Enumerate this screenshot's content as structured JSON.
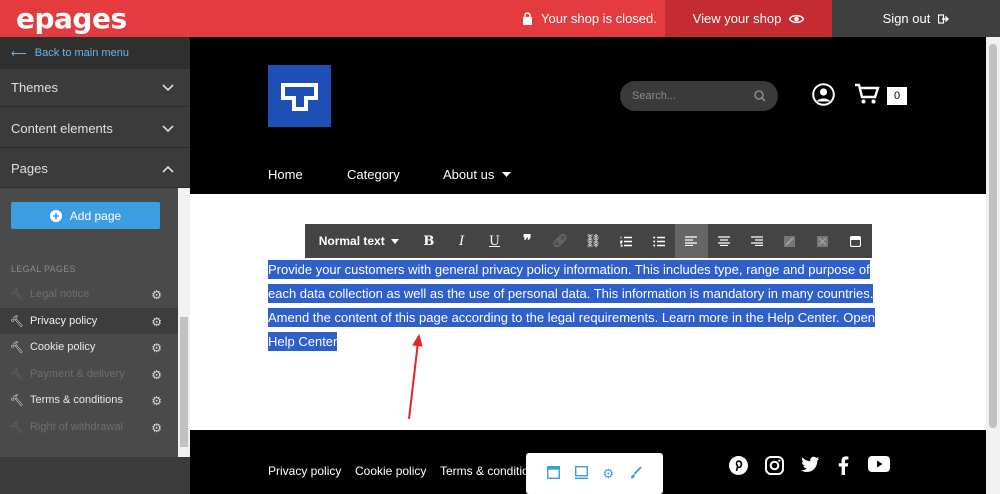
{
  "topbar": {
    "logo": "epages",
    "closed_text": "Your shop is closed.",
    "view_shop": "View your shop",
    "sign_out": "Sign out"
  },
  "sidebar": {
    "back": "Back to main menu",
    "sections": [
      "Themes",
      "Content elements",
      "Pages"
    ],
    "add_page": "Add page",
    "legal_heading": "LEGAL PAGES",
    "pages": [
      {
        "label": "Legal notice",
        "state": "dim"
      },
      {
        "label": "Privacy policy",
        "state": "active"
      },
      {
        "label": "Cookie policy",
        "state": "normal"
      },
      {
        "label": "Payment & delivery",
        "state": "dim"
      },
      {
        "label": "Terms & conditions",
        "state": "normal"
      },
      {
        "label": "Right of withdrawal",
        "state": "dim"
      }
    ]
  },
  "shop": {
    "search_placeholder": "Search...",
    "cart_count": "0",
    "nav": [
      "Home",
      "Category",
      "About us"
    ]
  },
  "toolbar": {
    "format": "Normal text"
  },
  "content": {
    "lines": [
      "Provide your customers with general privacy policy information. This includes type, range and purpose of",
      "each data collection as well as the use of personal data. This information is mandatory in many countries.",
      "Amend the content of this page according to the legal requirements. Learn more in the Help Center. Open",
      "Help Center"
    ]
  },
  "footer": {
    "links": [
      "Privacy policy",
      "Cookie policy",
      "Terms & conditio"
    ]
  },
  "colors": {
    "brand_red": "#e43b3f",
    "accent_blue": "#3c9ee0",
    "selection": "#2f5fc9"
  }
}
